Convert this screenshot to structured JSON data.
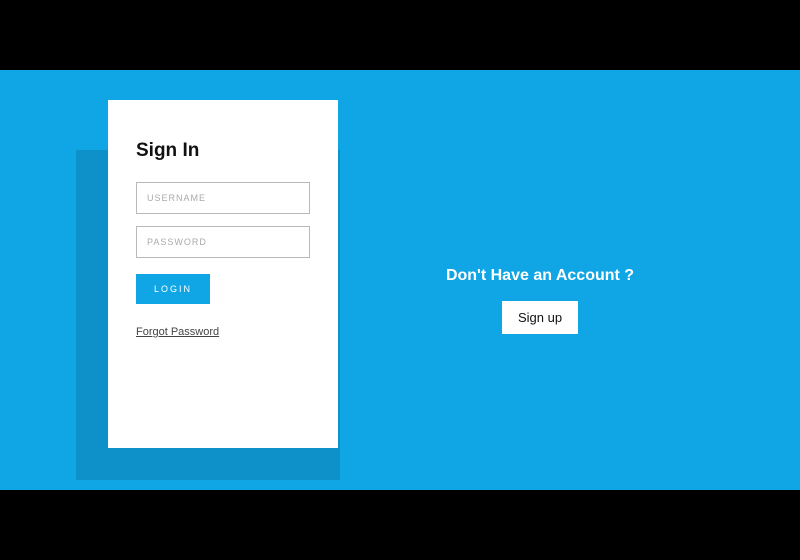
{
  "colors": {
    "accent": "#10a6e5",
    "card_bg": "#ffffff",
    "page_bg": "#000000"
  },
  "card": {
    "title": "Sign In",
    "username_placeholder": "USERNAME",
    "password_placeholder": "PASSWORD",
    "login_label": "LOGIN",
    "forgot_label": "Forgot Password"
  },
  "signup": {
    "prompt": "Don't Have an Account ?",
    "button_label": "Sign up"
  }
}
